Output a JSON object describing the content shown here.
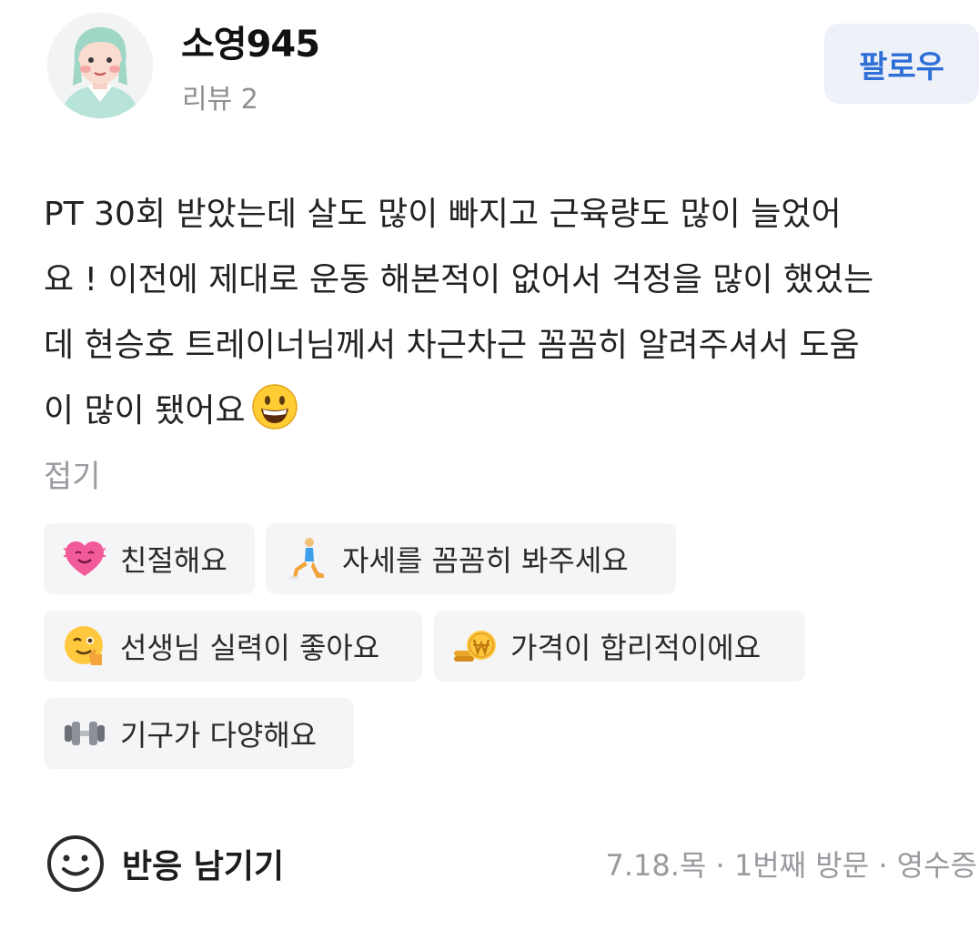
{
  "user": {
    "name": "소영945",
    "review_count_label": "리뷰 2"
  },
  "follow_button": {
    "label": "팔로우"
  },
  "review": {
    "line1": "PT 30회 받았는데 살도 많이 빠지고 근육량도 많이 늘었어",
    "line2": "요 ! 이전에 제대로 운동 해본적이 없어서 걱정을 많이 했었는",
    "line3": "데 현승호 트레이너님께서 차근차근 꼼꼼히 알려주셔서 도움",
    "line4": "이 많이 됐어요",
    "collapse_label": "접기"
  },
  "tags": [
    {
      "label": "친절해요",
      "icon": "heart-face-icon"
    },
    {
      "label": "자세를 꼼꼼히 봐주세요",
      "icon": "lunge-person-icon"
    },
    {
      "label": "선생님 실력이 좋아요",
      "icon": "wink-thumbs-up-icon"
    },
    {
      "label": "가격이 합리적이에요",
      "icon": "won-coin-icon"
    },
    {
      "label": "기구가 다양해요",
      "icon": "dumbbell-icon"
    }
  ],
  "reaction": {
    "label": "반응 남기기"
  },
  "meta": {
    "text": "7.18.목 · 1번째 방문 · 영수증"
  },
  "colors": {
    "accent": "#2f6fd8",
    "follow_bg": "#eef1f7",
    "tag_bg": "#f5f5f7",
    "muted_text": "#9a9aa0"
  }
}
